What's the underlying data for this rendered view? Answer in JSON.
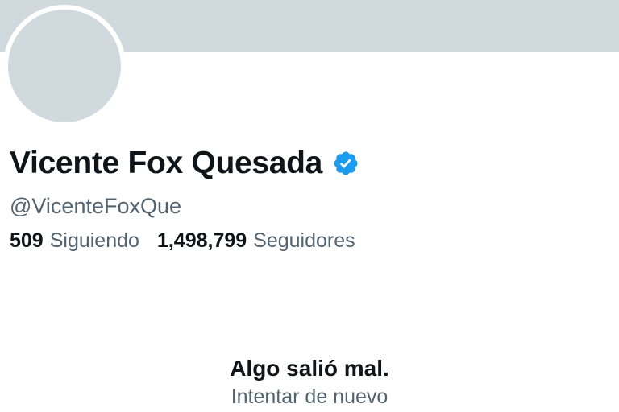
{
  "profile": {
    "display_name": "Vicente Fox Quesada",
    "handle": "@VicenteFoxQue",
    "verified_icon": "verified-badge-icon",
    "verified_color": "#1d9bf0"
  },
  "stats": {
    "following_count": "509",
    "following_label": "Siguiendo",
    "followers_count": "1,498,799",
    "followers_label": "Seguidores"
  },
  "error": {
    "title": "Algo salió mal.",
    "retry_label": "Intentar de nuevo"
  },
  "colors": {
    "banner": "#cfd9de",
    "avatar_placeholder": "#cfd9de",
    "primary_text": "#0f1419",
    "secondary_text": "#536471"
  }
}
